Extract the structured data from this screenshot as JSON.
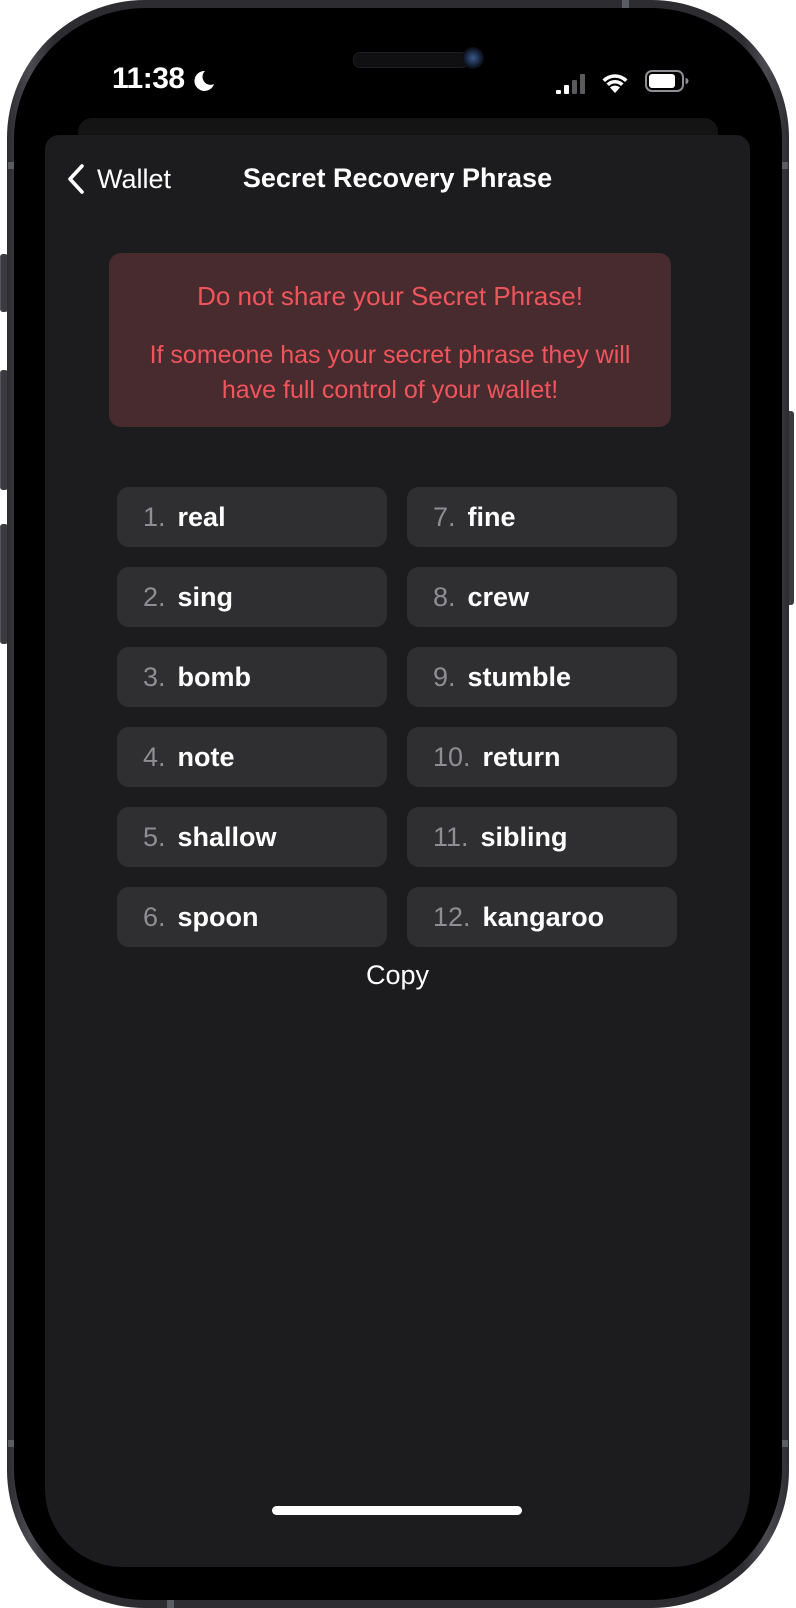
{
  "status_bar": {
    "time": "11:38",
    "focus_icon": "moon-icon",
    "signal_icon": "cellular-signal-icon",
    "wifi_icon": "wifi-icon",
    "battery_icon": "battery-icon"
  },
  "nav": {
    "back_label": "Wallet",
    "back_icon": "chevron-left-icon",
    "title": "Secret Recovery Phrase"
  },
  "warning": {
    "title": "Do not share your Secret Phrase!",
    "body": "If someone has your secret phrase they will have full control of your wallet!",
    "color": "#f2545b",
    "background": "#472b2f"
  },
  "words": [
    {
      "num": "1.",
      "word": "real"
    },
    {
      "num": "2.",
      "word": "sing"
    },
    {
      "num": "3.",
      "word": "bomb"
    },
    {
      "num": "4.",
      "word": "note"
    },
    {
      "num": "5.",
      "word": "shallow"
    },
    {
      "num": "6.",
      "word": "spoon"
    },
    {
      "num": "7.",
      "word": "fine"
    },
    {
      "num": "8.",
      "word": "crew"
    },
    {
      "num": "9.",
      "word": "stumble"
    },
    {
      "num": "10.",
      "word": "return"
    },
    {
      "num": "11.",
      "word": "sibling"
    },
    {
      "num": "12.",
      "word": "kangaroo"
    }
  ],
  "copy_label": "Copy"
}
